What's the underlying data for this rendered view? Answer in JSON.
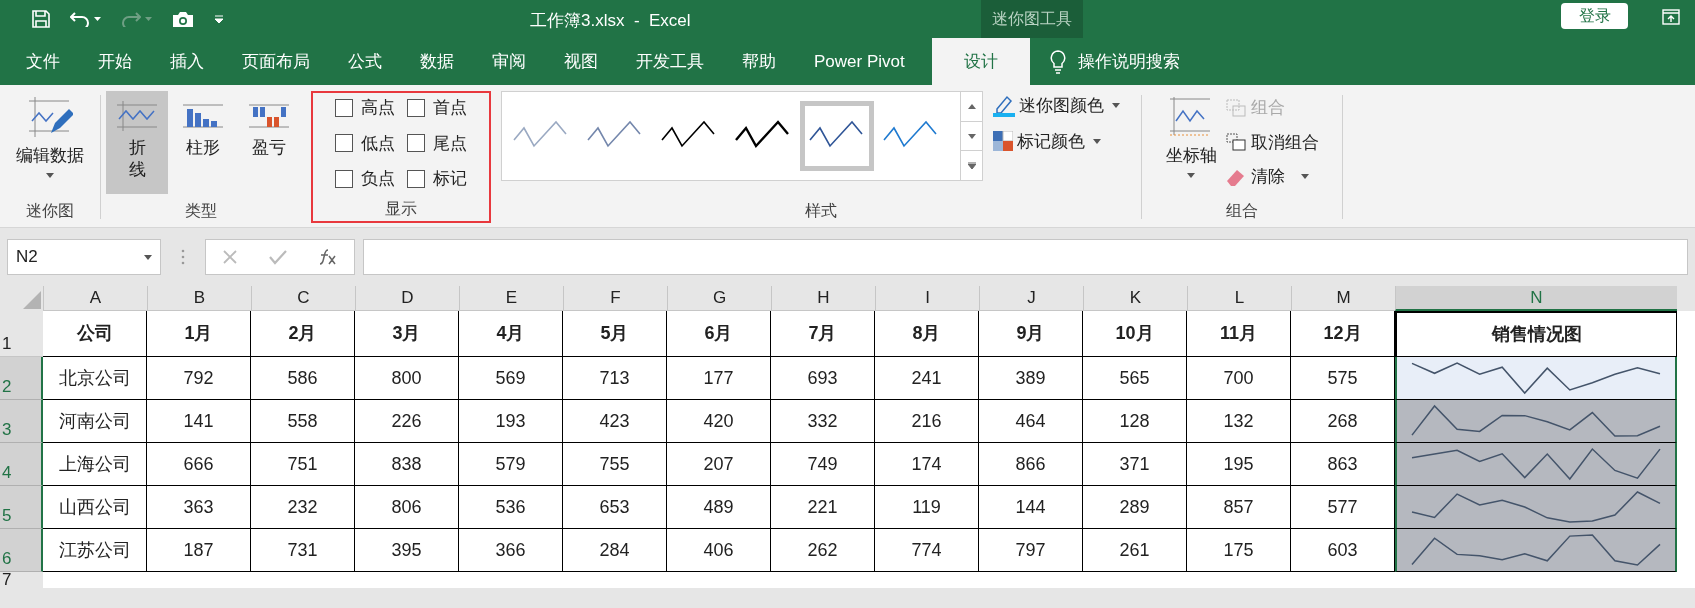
{
  "title_bar": {
    "title": "工作簿3.xlsx  -  Excel",
    "context_group": "迷你图工具",
    "login": "登录"
  },
  "tabs": [
    {
      "label": "文件",
      "selected": false
    },
    {
      "label": "开始",
      "selected": false
    },
    {
      "label": "插入",
      "selected": false
    },
    {
      "label": "页面布局",
      "selected": false
    },
    {
      "label": "公式",
      "selected": false
    },
    {
      "label": "数据",
      "selected": false
    },
    {
      "label": "审阅",
      "selected": false
    },
    {
      "label": "视图",
      "selected": false
    },
    {
      "label": "开发工具",
      "selected": false
    },
    {
      "label": "帮助",
      "selected": false
    },
    {
      "label": "Power Pivot",
      "selected": false
    },
    {
      "label": "设计",
      "selected": true
    }
  ],
  "tell_me": "操作说明搜索",
  "ribbon": {
    "sparkline_group": {
      "button": "编辑数据",
      "label": "迷你图"
    },
    "type_group": {
      "label": "类型",
      "types": [
        {
          "label": "折线",
          "kind": "line",
          "selected": true
        },
        {
          "label": "柱形",
          "kind": "column",
          "selected": false
        },
        {
          "label": "盈亏",
          "kind": "winloss",
          "selected": false
        }
      ]
    },
    "show_group": {
      "label": "显示",
      "outlined": true,
      "options": [
        {
          "label": "高点",
          "checked": false
        },
        {
          "label": "首点",
          "checked": false
        },
        {
          "label": "低点",
          "checked": false
        },
        {
          "label": "尾点",
          "checked": false
        },
        {
          "label": "负点",
          "checked": false
        },
        {
          "label": "标记",
          "checked": false
        }
      ]
    },
    "style_group": {
      "label": "样式",
      "styles": [
        {
          "color": "#9aa9c2",
          "selected": false
        },
        {
          "color": "#7487ac",
          "selected": false
        },
        {
          "color": "#000000",
          "selected": false
        },
        {
          "color": "#000000",
          "selected": false
        },
        {
          "color": "#2f5597",
          "selected": true
        },
        {
          "color": "#1f7ad0",
          "selected": false
        }
      ],
      "sparkline_color": "迷你图颜色",
      "marker_color": "标记颜色"
    },
    "group_group": {
      "label": "组合",
      "axis": "坐标轴",
      "group": {
        "label": "组合",
        "disabled": true
      },
      "ungroup": {
        "label": "取消组合",
        "disabled": false
      },
      "clear": "清除"
    }
  },
  "name_box": "N2",
  "columns": [
    {
      "label": "A",
      "selected": false
    },
    {
      "label": "B",
      "selected": false
    },
    {
      "label": "C",
      "selected": false
    },
    {
      "label": "D",
      "selected": false
    },
    {
      "label": "E",
      "selected": false
    },
    {
      "label": "F",
      "selected": false
    },
    {
      "label": "G",
      "selected": false
    },
    {
      "label": "H",
      "selected": false
    },
    {
      "label": "I",
      "selected": false
    },
    {
      "label": "J",
      "selected": false
    },
    {
      "label": "K",
      "selected": false
    },
    {
      "label": "L",
      "selected": false
    },
    {
      "label": "M",
      "selected": false
    },
    {
      "label": "N",
      "selected": true
    }
  ],
  "header_row": {
    "number": "1",
    "cells": [
      "公司",
      "1月",
      "2月",
      "3月",
      "4月",
      "5月",
      "6月",
      "7月",
      "8月",
      "9月",
      "10月",
      "11月",
      "12月",
      "销售情况图"
    ]
  },
  "rows": [
    {
      "number": "2",
      "active": true,
      "cells": [
        "北京公司",
        "792",
        "586",
        "800",
        "569",
        "713",
        "177",
        "693",
        "241",
        "389",
        "565",
        "700",
        "575"
      ]
    },
    {
      "number": "3",
      "active": false,
      "cells": [
        "河南公司",
        "141",
        "558",
        "226",
        "193",
        "423",
        "420",
        "332",
        "216",
        "464",
        "128",
        "132",
        "268"
      ]
    },
    {
      "number": "4",
      "active": false,
      "cells": [
        "上海公司",
        "666",
        "751",
        "838",
        "579",
        "755",
        "207",
        "749",
        "174",
        "866",
        "371",
        "195",
        "863"
      ]
    },
    {
      "number": "5",
      "active": false,
      "cells": [
        "山西公司",
        "363",
        "232",
        "806",
        "536",
        "653",
        "489",
        "221",
        "119",
        "144",
        "289",
        "857",
        "577"
      ]
    },
    {
      "number": "6",
      "active": false,
      "cells": [
        "江苏公司",
        "187",
        "731",
        "395",
        "366",
        "284",
        "406",
        "262",
        "774",
        "797",
        "261",
        "175",
        "603"
      ]
    }
  ],
  "partial_row": "7"
}
